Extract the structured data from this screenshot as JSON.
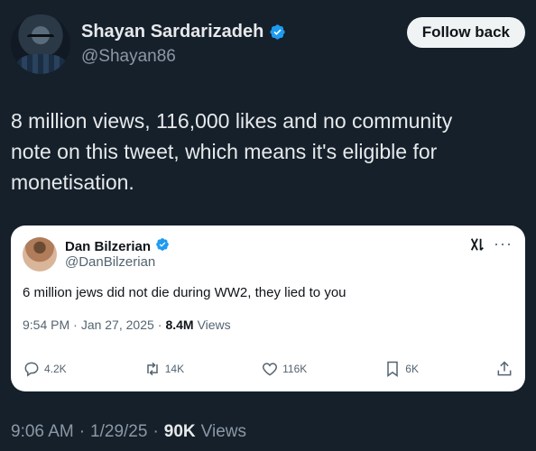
{
  "author": {
    "display_name": "Shayan Sardarizadeh",
    "handle": "@Shayan86",
    "follow_button": "Follow back"
  },
  "tweet": {
    "text": "8 million views, 116,000 likes and no community\nnote on this tweet, which means it's eligible for\nmonetisation."
  },
  "quoted": {
    "display_name": "Dan Bilzerian",
    "handle": "@DanBilzerian",
    "more": "···",
    "text": "6 million jews did not die during WW2, they lied to you",
    "time": "9:54 PM",
    "date": "Jan 27, 2025",
    "views_count": "8.4M",
    "views_label": "Views",
    "actions": {
      "replies": "4.2K",
      "reposts": "14K",
      "likes": "116K",
      "bookmarks": "6K"
    }
  },
  "footer": {
    "time": "9:06 AM",
    "date": "1/29/25",
    "views_count": "90K",
    "views_label": "Views"
  },
  "colors": {
    "background": "#15202b",
    "verified": "#1d9bf0",
    "text_primary": "#e7e9ea",
    "text_secondary": "#8b98a5"
  }
}
